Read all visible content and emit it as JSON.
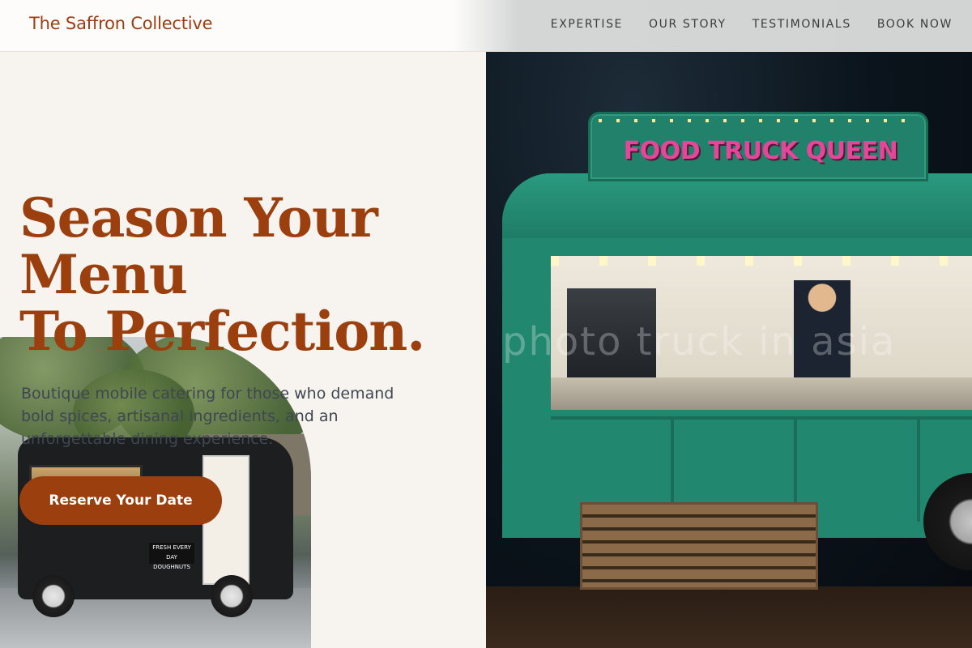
{
  "header": {
    "brand": "The Saffron Collective",
    "nav": [
      {
        "label": "EXPERTISE"
      },
      {
        "label": "OUR STORY"
      },
      {
        "label": "TESTIMONIALS"
      },
      {
        "label": "BOOK NOW"
      }
    ]
  },
  "hero": {
    "headline_line1": "Season Your",
    "headline_line2": "Menu",
    "headline_line3": "To Perfection.",
    "subtext": "Boutique mobile catering for those who demand bold spices, artisanal ingredients, and an unforgettable dining experience.",
    "cta_label": "Reserve Your Date"
  },
  "images": {
    "small_photo_sign": "FRESH EVERY DAY DOUGHNUTS",
    "big_photo_sign": "FOOD TRUCK QUEEN",
    "big_photo_watermark": "photo truck in asia"
  },
  "colors": {
    "accent": "#9b3f0f",
    "background": "#f7f3ee",
    "text_body": "#3e4752"
  }
}
